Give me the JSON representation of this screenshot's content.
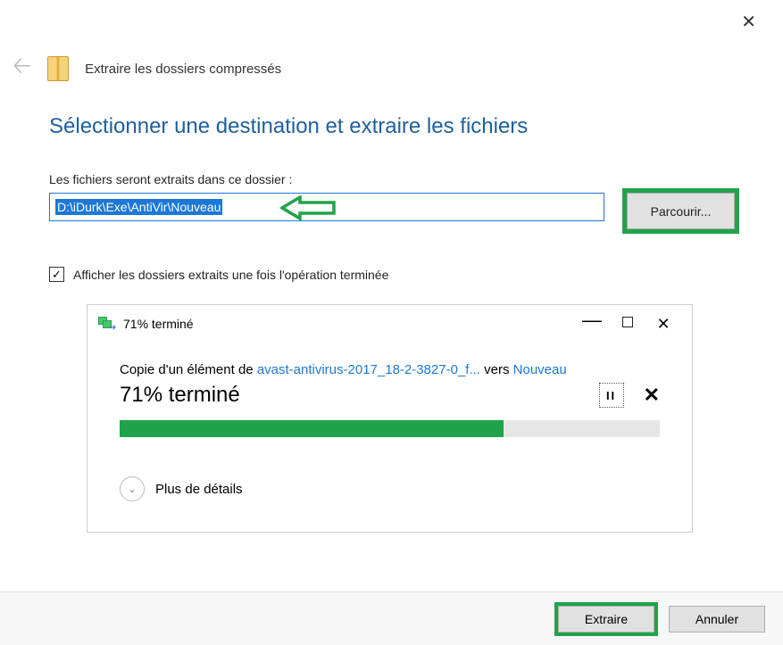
{
  "header": {
    "title": "Extraire les dossiers compressés"
  },
  "main": {
    "heading": "Sélectionner une destination et extraire les fichiers",
    "dest_label": "Les fichiers seront extraits dans ce dossier :",
    "path_value": "D:\\iDurk\\Exe\\AntiVir\\Nouveau",
    "browse_label": "Parcourir...",
    "checkbox_label": "Afficher les dossiers extraits une fois l'opération terminée",
    "checkbox_checked": "✓"
  },
  "progress": {
    "title": "71% terminé",
    "copy_prefix": "Copie d'un élément de ",
    "source_link": "avast-antivirus-2017_18-2-3827-0_f...",
    "middle": " vers ",
    "dest_link": "Nouveau",
    "percent_text": "71% terminé",
    "percent_value": 71,
    "pause_glyph": "II",
    "details_label": "Plus de détails"
  },
  "footer": {
    "extract_label": "Extraire",
    "cancel_label": "Annuler"
  },
  "colors": {
    "accent_green": "#1fa34a",
    "accent_blue": "#1c78d6"
  }
}
